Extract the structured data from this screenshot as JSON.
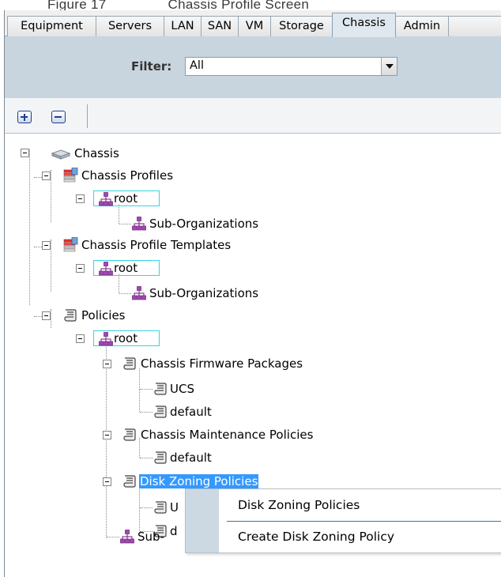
{
  "caption": {
    "figure": "Figure 17",
    "title": "Chassis Profile Screen"
  },
  "tabs": [
    "Equipment",
    "Servers",
    "LAN",
    "SAN",
    "VM",
    "Storage",
    "Chassis",
    "Admin"
  ],
  "active_tab": "Chassis",
  "filter": {
    "label": "Filter:",
    "value": "All"
  },
  "toolbar": {
    "expand_icon": "plus-icon",
    "collapse_icon": "minus-icon"
  },
  "tree": {
    "chassis": "Chassis",
    "chassis_profiles": "Chassis Profiles",
    "root_1": "root",
    "suborg_1": "Sub-Organizations",
    "chassis_profile_templates": "Chassis Profile Templates",
    "root_2": "root",
    "suborg_2": "Sub-Organizations",
    "policies": "Policies",
    "root_3": "root",
    "firmware_packages": "Chassis Firmware Packages",
    "fw_ucs": "UCS",
    "fw_default": "default",
    "maintenance_policies": "Chassis Maintenance Policies",
    "mp_default": "default",
    "disk_zoning": "Disk Zoning Policies",
    "dz_child_1": "U",
    "dz_child_2": "d",
    "suborg_3": "Sub-"
  },
  "context_menu": {
    "header": "Disk Zoning Policies",
    "create": "Create Disk Zoning Policy"
  },
  "colors": {
    "selection": "#3399ff",
    "focus_border": "#38d3e0",
    "filter_band": "#c8d5df",
    "org_icon": "#8e2ba0"
  }
}
